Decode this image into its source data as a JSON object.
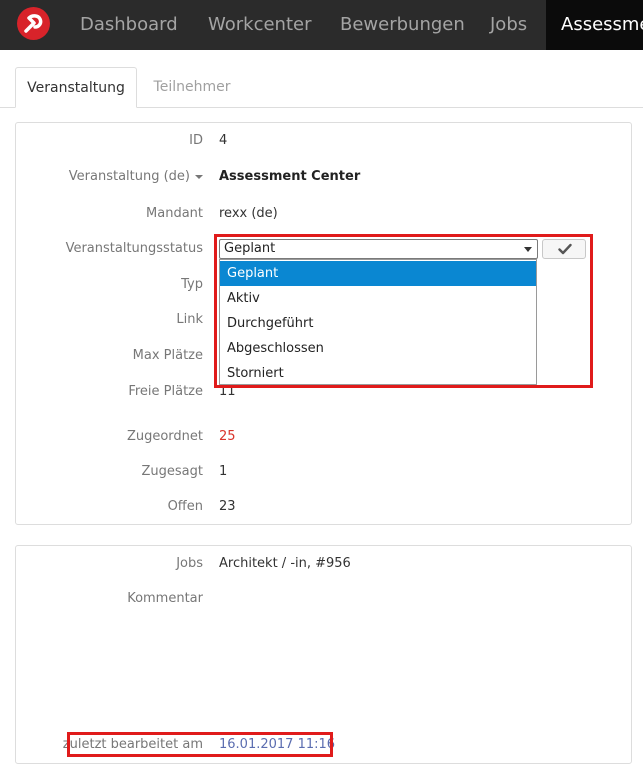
{
  "topnav": {
    "items": [
      {
        "label": "Dashboard"
      },
      {
        "label": "Workcenter"
      },
      {
        "label": "Bewerbungen"
      },
      {
        "label": "Jobs"
      },
      {
        "label": "Assessme"
      }
    ]
  },
  "tabs": [
    {
      "label": "Veranstaltung",
      "active": true
    },
    {
      "label": "Teilnehmer",
      "active": false
    }
  ],
  "details": {
    "id_label": "ID",
    "id_value": "4",
    "event_label": "Veranstaltung (de)",
    "event_value": "Assessment Center",
    "mandant_label": "Mandant",
    "mandant_value": "rexx (de)",
    "status_label": "Veranstaltungsstatus",
    "status_value": "Geplant",
    "typ_label": "Typ",
    "link_label": "Link",
    "max_label": "Max Plätze",
    "free_label": "Freie Plätze",
    "free_value": "11",
    "assigned_label": "Zugeordnet",
    "assigned_value": "25",
    "confirmed_label": "Zugesagt",
    "confirmed_value": "1",
    "open_label": "Offen",
    "open_value": "23"
  },
  "status_dropdown": {
    "options": [
      "Geplant",
      "Aktiv",
      "Durchgeführt",
      "Abgeschlossen",
      "Storniert"
    ],
    "selected_index": 0
  },
  "panel2": {
    "jobs_label": "Jobs",
    "jobs_value": "Architekt / -in, #956",
    "comment_label": "Kommentar",
    "edited_label": "zuletzt bearbeitet am",
    "edited_value": "16.01.2017 11:16"
  },
  "colors": {
    "accent": "#0a87d2",
    "highlight": "#e01b1b",
    "nav_bg": "#2b2b2b",
    "logo": "#d8232a"
  }
}
